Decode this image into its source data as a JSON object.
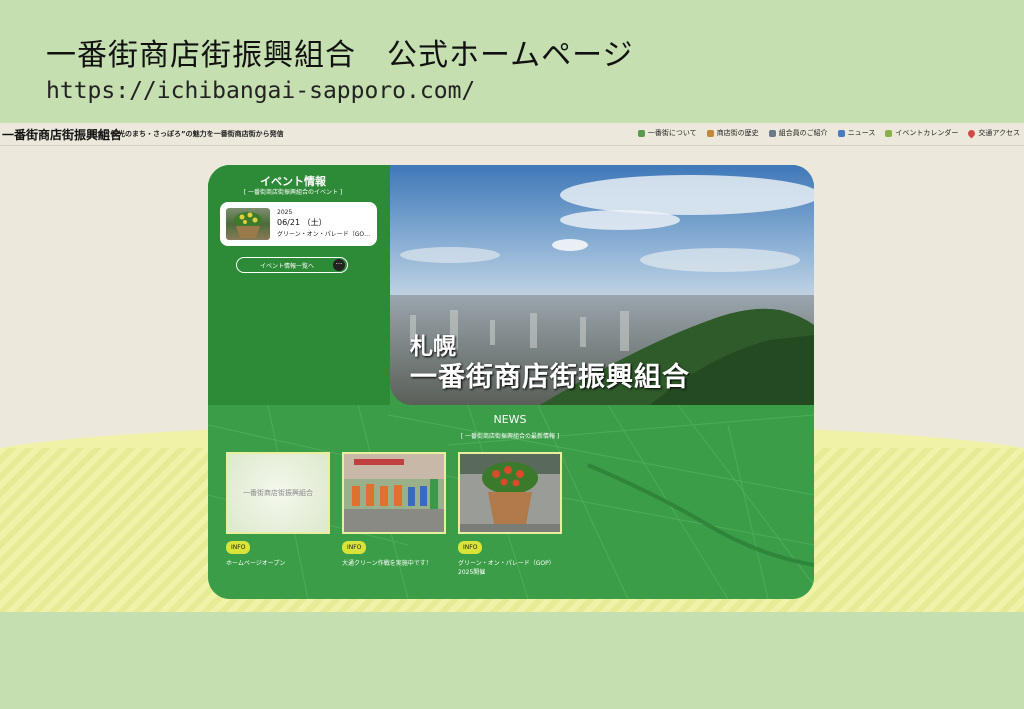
{
  "slide": {
    "title": "一番街商店街振興組合　公式ホームページ",
    "url": "https://ichibangai-sapporo.com/"
  },
  "site": {
    "logo": "一番街商店街振興組合",
    "tagline": "食と観光のまち・さっぽろ”の魅力を一番街商店街から発信",
    "nav": [
      {
        "label": "一番街について",
        "icon": "building-icon",
        "color": "#5a9a4a"
      },
      {
        "label": "商店街の歴史",
        "icon": "book-icon",
        "color": "#c08a3a"
      },
      {
        "label": "組合員のご紹介",
        "icon": "people-icon",
        "color": "#6a7a8a"
      },
      {
        "label": "ニュース",
        "icon": "news-icon",
        "color": "#4a7ac0"
      },
      {
        "label": "イベントカレンダー",
        "icon": "calendar-icon",
        "color": "#8ab04a"
      },
      {
        "label": "交通アクセス",
        "icon": "pin-icon",
        "color": "#d04a4a"
      }
    ]
  },
  "event": {
    "title": "イベント情報",
    "subtitle": "[ 一番街商店街振興組合のイベント ]",
    "item": {
      "year": "2025",
      "date": "06/21 （土）",
      "name": "グリーン・オン・パレード（GO…"
    },
    "button": "イベント情報一覧へ"
  },
  "hero": {
    "line1": "札幌",
    "line2": "一番街商店街振興組合"
  },
  "news": {
    "title": "NEWS",
    "subtitle": "[ 一番街商店街振興組合の最新情報 ]",
    "items": [
      {
        "thumb_text": "一番街商店街振興組合",
        "badge": "INFO",
        "text": "ホームページオープン"
      },
      {
        "badge": "INFO",
        "text": "大通クリーン作戦を実施中です！"
      },
      {
        "badge": "INFO",
        "text": "グリーン・オン・パレード（GOP） 2025開催"
      }
    ]
  },
  "colors": {
    "green_dark": "#2d8a37",
    "green": "#3a9a46",
    "badge": "#d9e33a",
    "bg": "#c5dfb0"
  }
}
